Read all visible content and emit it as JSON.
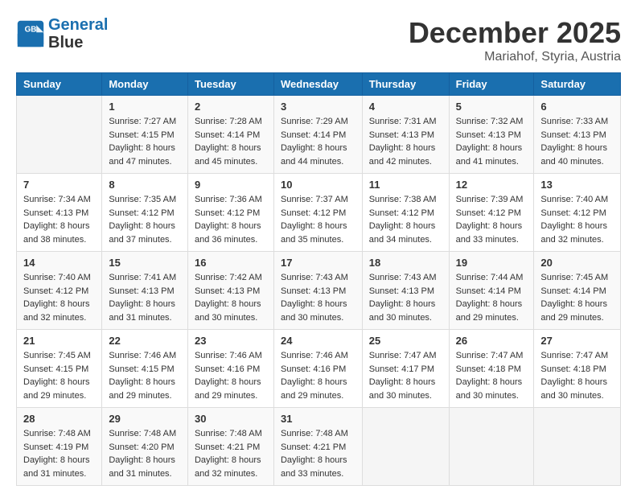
{
  "header": {
    "logo_line1": "General",
    "logo_line2": "Blue",
    "month": "December 2025",
    "location": "Mariahof, Styria, Austria"
  },
  "weekdays": [
    "Sunday",
    "Monday",
    "Tuesday",
    "Wednesday",
    "Thursday",
    "Friday",
    "Saturday"
  ],
  "weeks": [
    [
      {
        "day": "",
        "info": ""
      },
      {
        "day": "1",
        "info": "Sunrise: 7:27 AM\nSunset: 4:15 PM\nDaylight: 8 hours\nand 47 minutes."
      },
      {
        "day": "2",
        "info": "Sunrise: 7:28 AM\nSunset: 4:14 PM\nDaylight: 8 hours\nand 45 minutes."
      },
      {
        "day": "3",
        "info": "Sunrise: 7:29 AM\nSunset: 4:14 PM\nDaylight: 8 hours\nand 44 minutes."
      },
      {
        "day": "4",
        "info": "Sunrise: 7:31 AM\nSunset: 4:13 PM\nDaylight: 8 hours\nand 42 minutes."
      },
      {
        "day": "5",
        "info": "Sunrise: 7:32 AM\nSunset: 4:13 PM\nDaylight: 8 hours\nand 41 minutes."
      },
      {
        "day": "6",
        "info": "Sunrise: 7:33 AM\nSunset: 4:13 PM\nDaylight: 8 hours\nand 40 minutes."
      }
    ],
    [
      {
        "day": "7",
        "info": "Sunrise: 7:34 AM\nSunset: 4:13 PM\nDaylight: 8 hours\nand 38 minutes."
      },
      {
        "day": "8",
        "info": "Sunrise: 7:35 AM\nSunset: 4:12 PM\nDaylight: 8 hours\nand 37 minutes."
      },
      {
        "day": "9",
        "info": "Sunrise: 7:36 AM\nSunset: 4:12 PM\nDaylight: 8 hours\nand 36 minutes."
      },
      {
        "day": "10",
        "info": "Sunrise: 7:37 AM\nSunset: 4:12 PM\nDaylight: 8 hours\nand 35 minutes."
      },
      {
        "day": "11",
        "info": "Sunrise: 7:38 AM\nSunset: 4:12 PM\nDaylight: 8 hours\nand 34 minutes."
      },
      {
        "day": "12",
        "info": "Sunrise: 7:39 AM\nSunset: 4:12 PM\nDaylight: 8 hours\nand 33 minutes."
      },
      {
        "day": "13",
        "info": "Sunrise: 7:40 AM\nSunset: 4:12 PM\nDaylight: 8 hours\nand 32 minutes."
      }
    ],
    [
      {
        "day": "14",
        "info": "Sunrise: 7:40 AM\nSunset: 4:12 PM\nDaylight: 8 hours\nand 32 minutes."
      },
      {
        "day": "15",
        "info": "Sunrise: 7:41 AM\nSunset: 4:13 PM\nDaylight: 8 hours\nand 31 minutes."
      },
      {
        "day": "16",
        "info": "Sunrise: 7:42 AM\nSunset: 4:13 PM\nDaylight: 8 hours\nand 30 minutes."
      },
      {
        "day": "17",
        "info": "Sunrise: 7:43 AM\nSunset: 4:13 PM\nDaylight: 8 hours\nand 30 minutes."
      },
      {
        "day": "18",
        "info": "Sunrise: 7:43 AM\nSunset: 4:13 PM\nDaylight: 8 hours\nand 30 minutes."
      },
      {
        "day": "19",
        "info": "Sunrise: 7:44 AM\nSunset: 4:14 PM\nDaylight: 8 hours\nand 29 minutes."
      },
      {
        "day": "20",
        "info": "Sunrise: 7:45 AM\nSunset: 4:14 PM\nDaylight: 8 hours\nand 29 minutes."
      }
    ],
    [
      {
        "day": "21",
        "info": "Sunrise: 7:45 AM\nSunset: 4:15 PM\nDaylight: 8 hours\nand 29 minutes."
      },
      {
        "day": "22",
        "info": "Sunrise: 7:46 AM\nSunset: 4:15 PM\nDaylight: 8 hours\nand 29 minutes."
      },
      {
        "day": "23",
        "info": "Sunrise: 7:46 AM\nSunset: 4:16 PM\nDaylight: 8 hours\nand 29 minutes."
      },
      {
        "day": "24",
        "info": "Sunrise: 7:46 AM\nSunset: 4:16 PM\nDaylight: 8 hours\nand 29 minutes."
      },
      {
        "day": "25",
        "info": "Sunrise: 7:47 AM\nSunset: 4:17 PM\nDaylight: 8 hours\nand 30 minutes."
      },
      {
        "day": "26",
        "info": "Sunrise: 7:47 AM\nSunset: 4:18 PM\nDaylight: 8 hours\nand 30 minutes."
      },
      {
        "day": "27",
        "info": "Sunrise: 7:47 AM\nSunset: 4:18 PM\nDaylight: 8 hours\nand 30 minutes."
      }
    ],
    [
      {
        "day": "28",
        "info": "Sunrise: 7:48 AM\nSunset: 4:19 PM\nDaylight: 8 hours\nand 31 minutes."
      },
      {
        "day": "29",
        "info": "Sunrise: 7:48 AM\nSunset: 4:20 PM\nDaylight: 8 hours\nand 31 minutes."
      },
      {
        "day": "30",
        "info": "Sunrise: 7:48 AM\nSunset: 4:21 PM\nDaylight: 8 hours\nand 32 minutes."
      },
      {
        "day": "31",
        "info": "Sunrise: 7:48 AM\nSunset: 4:21 PM\nDaylight: 8 hours\nand 33 minutes."
      },
      {
        "day": "",
        "info": ""
      },
      {
        "day": "",
        "info": ""
      },
      {
        "day": "",
        "info": ""
      }
    ]
  ]
}
